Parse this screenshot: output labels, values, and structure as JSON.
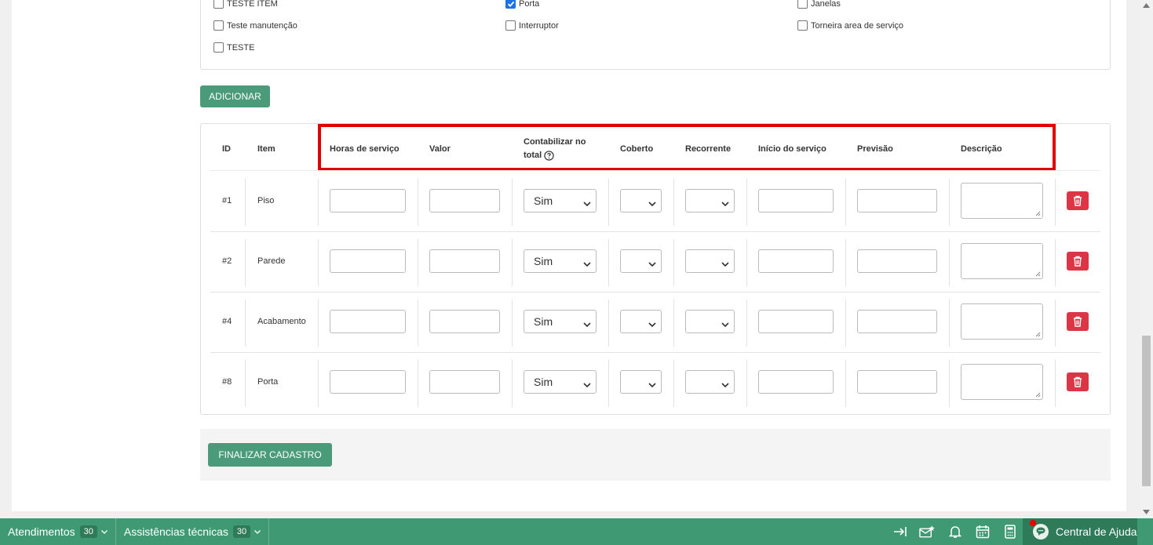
{
  "checklist": {
    "items": [
      {
        "label": "TESTE ITEM",
        "checked": false
      },
      {
        "label": "Porta",
        "checked": true
      },
      {
        "label": "Janelas",
        "checked": false
      },
      {
        "label": "Teste manutenção",
        "checked": false
      },
      {
        "label": "Interruptor",
        "checked": false
      },
      {
        "label": "Torneira area de serviço",
        "checked": false
      },
      {
        "label": "TESTE",
        "checked": false
      }
    ]
  },
  "buttons": {
    "add_label": "ADICIONAR",
    "finalize_label": "FINALIZAR CADASTRO"
  },
  "table": {
    "headers": {
      "id": "ID",
      "item": "Item",
      "hours": "Horas de serviço",
      "value": "Valor",
      "count_line1": "Contabilizar no",
      "count_line2": "total",
      "covered": "Coberto",
      "recurring": "Recorrente",
      "start": "Início do serviço",
      "forecast": "Previsão",
      "description": "Descrição"
    },
    "rows": [
      {
        "id": "#1",
        "item": "Piso",
        "count_total": "Sim"
      },
      {
        "id": "#2",
        "item": "Parede",
        "count_total": "Sim"
      },
      {
        "id": "#4",
        "item": "Acabamento",
        "count_total": "Sim"
      },
      {
        "id": "#8",
        "item": "Porta",
        "count_total": "Sim"
      }
    ]
  },
  "bottom_bar": {
    "attendances_label": "Atendimentos",
    "attendances_count": "30",
    "tech_label": "Assistências técnicas",
    "tech_count": "30",
    "help_label": "Central de Ajuda"
  },
  "colors": {
    "accent_green": "#4a9b7a",
    "bar_green": "#3f9a73",
    "delete_red": "#dc3545",
    "highlight_red": "#e00000"
  }
}
